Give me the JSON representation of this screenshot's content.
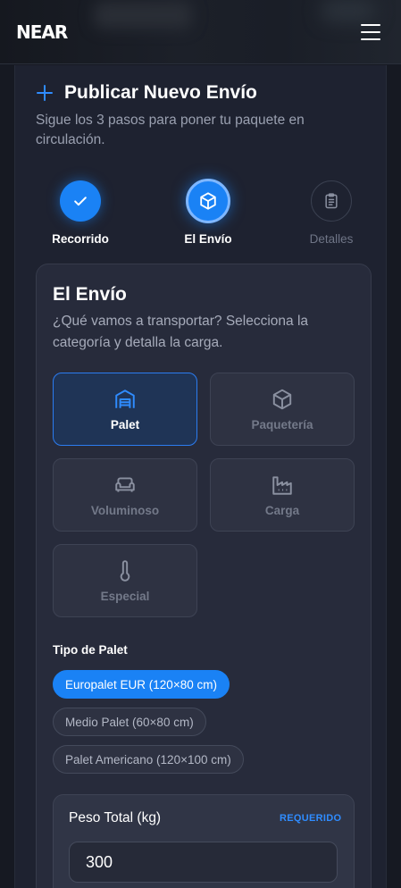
{
  "brand": {
    "logo": "NEAR"
  },
  "header": {
    "title": "Publicar Nuevo Envío",
    "subtitle": "Sigue los 3 pasos para poner tu paquete en circulación."
  },
  "steps": [
    {
      "label": "Recorrido",
      "state": "completed",
      "icon": "check-icon"
    },
    {
      "label": "El Envío",
      "state": "active",
      "icon": "box-icon"
    },
    {
      "label": "Detalles",
      "state": "pending",
      "icon": "clipboard-icon"
    }
  ],
  "card": {
    "title": "El Envío",
    "description": "¿Qué vamos a transportar? Selecciona la categoría y detalla la carga."
  },
  "categories": [
    {
      "label": "Palet",
      "icon": "warehouse-icon",
      "selected": true
    },
    {
      "label": "Paquetería",
      "icon": "box-icon",
      "selected": false
    },
    {
      "label": "Voluminoso",
      "icon": "sofa-icon",
      "selected": false
    },
    {
      "label": "Carga",
      "icon": "factory-icon",
      "selected": false
    },
    {
      "label": "Especial",
      "icon": "thermometer-icon",
      "selected": false
    }
  ],
  "pallet_type": {
    "label": "Tipo de Palet",
    "options": [
      {
        "label": "Europalet EUR (120×80 cm)",
        "selected": true
      },
      {
        "label": "Medio Palet (60×80 cm)",
        "selected": false
      },
      {
        "label": "Palet Americano (120×100 cm)",
        "selected": false
      }
    ]
  },
  "weight": {
    "label": "Peso Total (kg)",
    "required_text": "REQUERIDO",
    "value": "300"
  },
  "colors": {
    "accent": "#1a82f5",
    "background": "#161922",
    "card": "#272b3b"
  }
}
